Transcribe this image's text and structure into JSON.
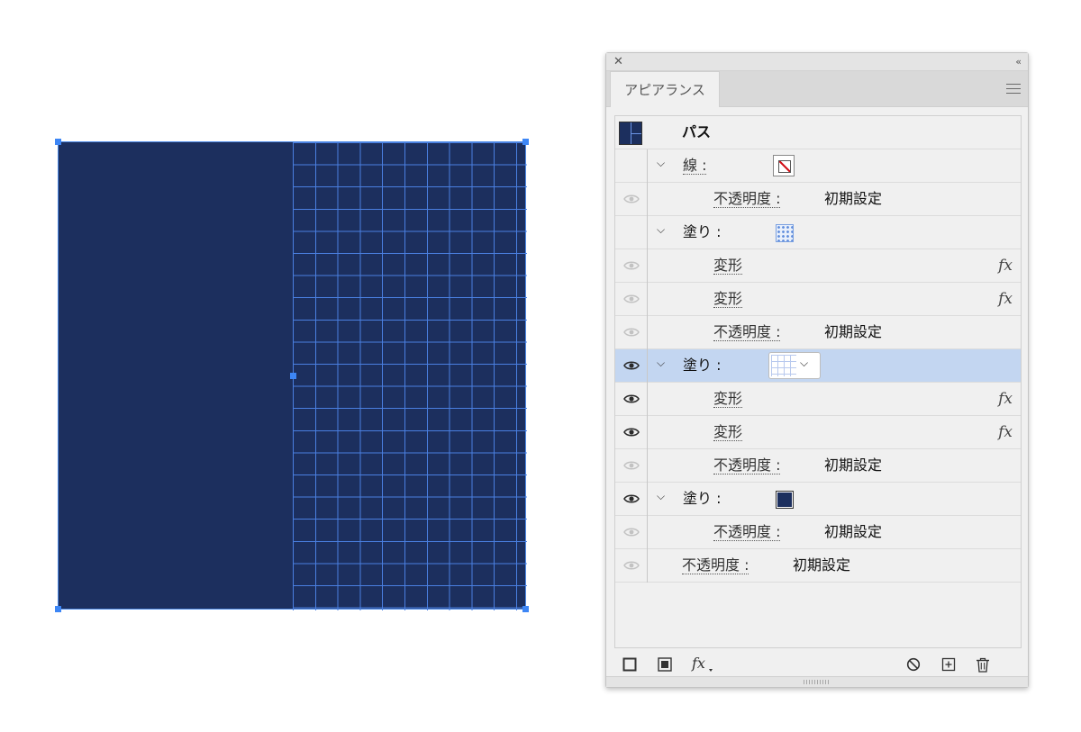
{
  "panel": {
    "tab_label": "アピアランス",
    "collapse_glyph": "‹‹",
    "close_glyph": "✕",
    "rows": [
      {
        "kind": "header",
        "label": "パス"
      },
      {
        "kind": "stroke",
        "label": "線 :"
      },
      {
        "kind": "opacity",
        "label": "不透明度 :",
        "value": "初期設定",
        "visible": false
      },
      {
        "kind": "fill",
        "label": "塗り :",
        "swatch": "dots"
      },
      {
        "kind": "effect",
        "label": "変形",
        "visible": false,
        "fx": "fx"
      },
      {
        "kind": "effect",
        "label": "変形",
        "visible": false,
        "fx": "fx"
      },
      {
        "kind": "opacity",
        "label": "不透明度 :",
        "value": "初期設定",
        "visible": false
      },
      {
        "kind": "fill",
        "label": "塗り :",
        "swatch": "grid",
        "selected": true,
        "visible": true
      },
      {
        "kind": "effect",
        "label": "変形",
        "visible": true,
        "fx": "fx"
      },
      {
        "kind": "effect",
        "label": "変形",
        "visible": true,
        "fx": "fx"
      },
      {
        "kind": "opacity",
        "label": "不透明度 :",
        "value": "初期設定",
        "visible": false
      },
      {
        "kind": "fill",
        "label": "塗り :",
        "swatch": "navy",
        "visible": true
      },
      {
        "kind": "opacity",
        "label": "不透明度 :",
        "value": "初期設定",
        "visible": false
      },
      {
        "kind": "object-opacity",
        "label": "不透明度 :",
        "value": "初期設定",
        "visible": false
      }
    ],
    "footer_icons": [
      "add-stroke-icon",
      "add-fill-icon",
      "fx-menu-icon",
      "clear-appearance-icon",
      "duplicate-item-icon",
      "delete-item-icon"
    ]
  },
  "colors": {
    "artwork_fill": "#1c2f5e",
    "grid_line": "#4a7fe0",
    "selection": "#3d86f5",
    "row_selected": "#c3d6f1"
  }
}
